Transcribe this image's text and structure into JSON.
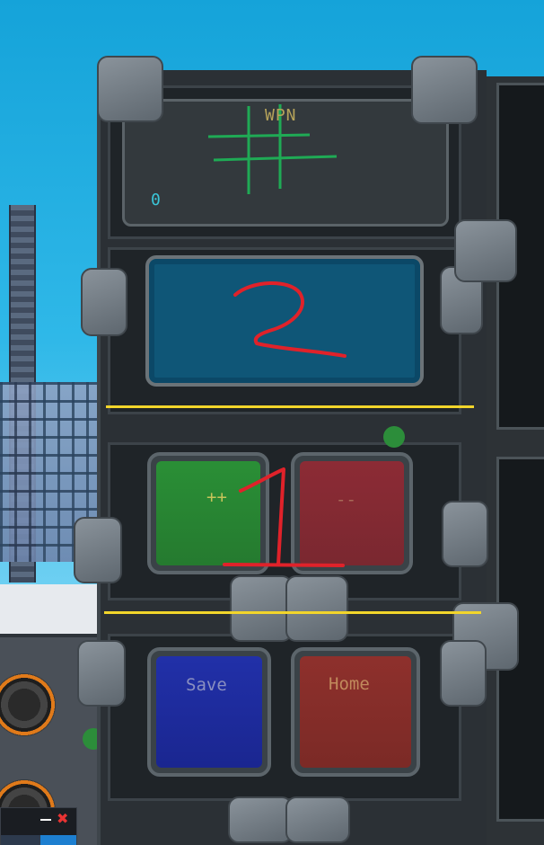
{
  "display": {
    "label": "WPN",
    "value": "0"
  },
  "keypad": {
    "increment_label": "++",
    "decrement_label": "--"
  },
  "bottom_buttons": {
    "save_label": "Save",
    "home_label": "Home"
  },
  "annotations": {
    "upper_marker": "2",
    "lower_marker": "1"
  },
  "colors": {
    "yellow_line": "#f2d52b",
    "red_marker": "#e0222a",
    "green_grid": "#1faa55",
    "wpn_text": "#b6a35a",
    "value_text": "#3ac6d8",
    "green_button": "#2f8d34",
    "red_button": "#8a2a32",
    "blue_button": "#1f2a9a",
    "home_button": "#8a2e2a"
  },
  "icons": {
    "grid": "hash-grid-icon",
    "window_close": "close-icon",
    "window_minimize": "minimize-icon"
  }
}
